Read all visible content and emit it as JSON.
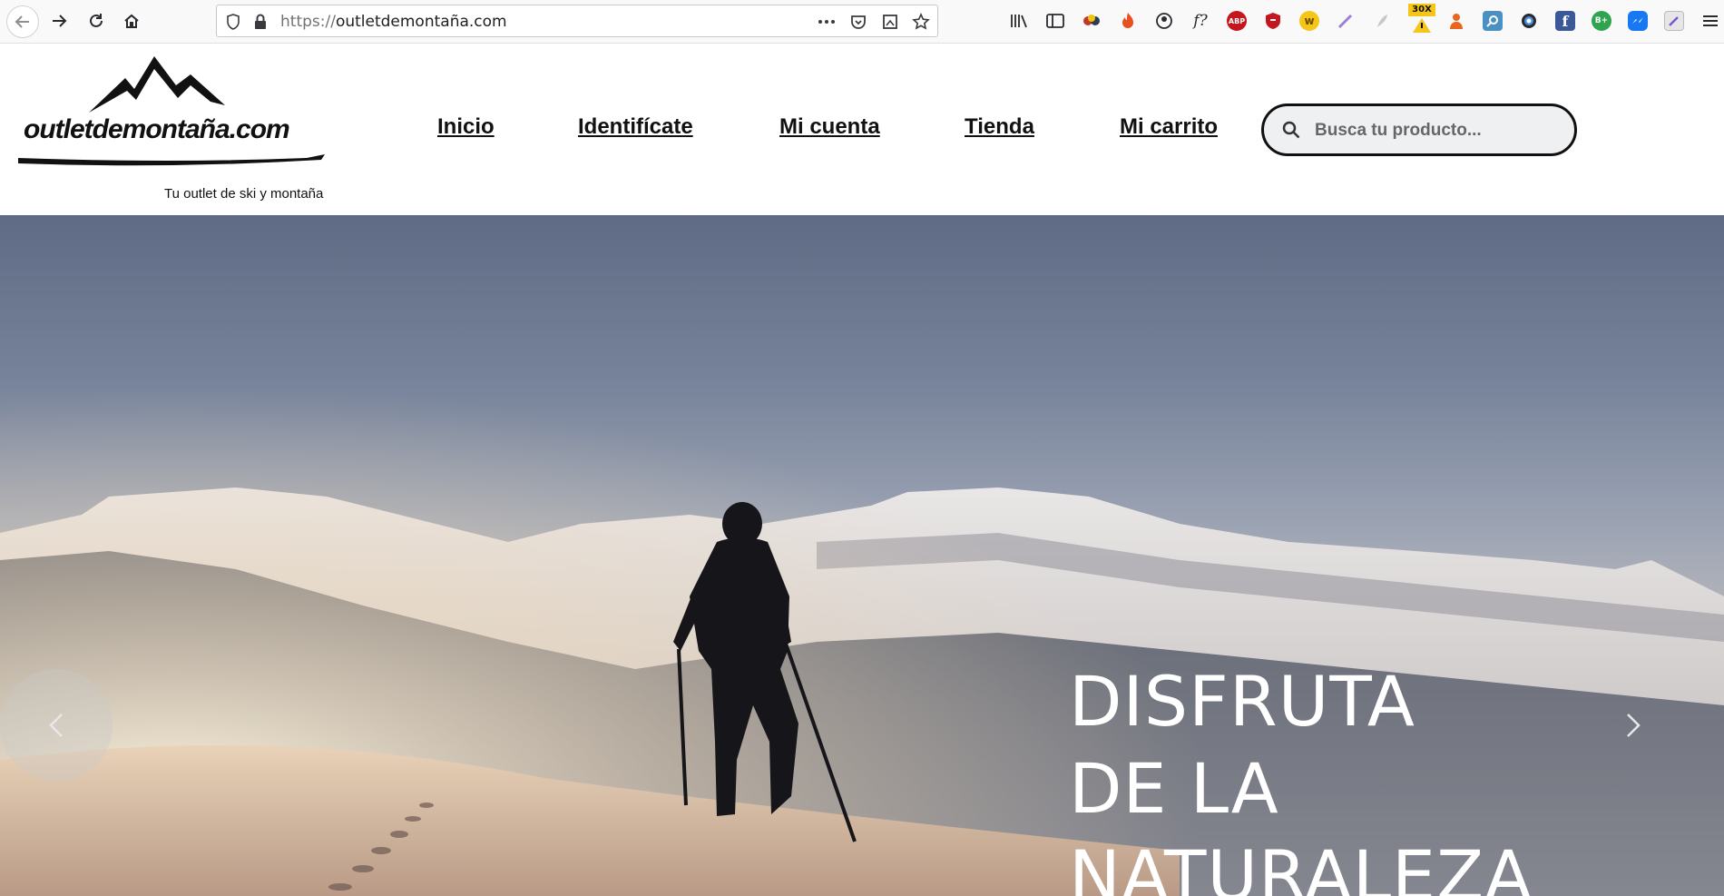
{
  "browser": {
    "url_protocol": "https://",
    "url_host": "outletdemontaña.com",
    "extensions": [
      {
        "name": "library-icon"
      },
      {
        "name": "sidebar-icon"
      },
      {
        "name": "color-picker-icon"
      },
      {
        "name": "flame-icon"
      },
      {
        "name": "account-icon"
      },
      {
        "name": "font-finder-icon",
        "label": "f?"
      },
      {
        "name": "adblock-plus-icon",
        "label": "ABP"
      },
      {
        "name": "shield-icon"
      },
      {
        "name": "w-extension-icon",
        "label": "w"
      },
      {
        "name": "pen-icon"
      },
      {
        "name": "feather-icon"
      },
      {
        "name": "warning-badge-icon",
        "label": "30X"
      },
      {
        "name": "user-orange-icon"
      },
      {
        "name": "magnifier-icon"
      },
      {
        "name": "circle-icon"
      },
      {
        "name": "facebook-icon",
        "label": "f"
      },
      {
        "name": "b-plus-icon",
        "label": "B+"
      },
      {
        "name": "messenger-icon"
      },
      {
        "name": "edit-image-icon"
      }
    ]
  },
  "site": {
    "logo_text": "outletdemontaña.com",
    "tagline": "Tu outlet de ski y montaña",
    "nav": [
      {
        "label": "Inicio"
      },
      {
        "label": "Identifícate"
      },
      {
        "label": "Mi cuenta"
      },
      {
        "label": "Tienda"
      },
      {
        "label": "Mi carrito"
      }
    ],
    "search_placeholder": "Busca tu producto..."
  },
  "hero": {
    "headline_lines": [
      "DISFRUTA",
      "DE LA",
      "NATURALEZA"
    ]
  },
  "colors": {
    "accent": "#111111",
    "hero_text": "#ffffff",
    "search_bg": "#eef0f2"
  }
}
